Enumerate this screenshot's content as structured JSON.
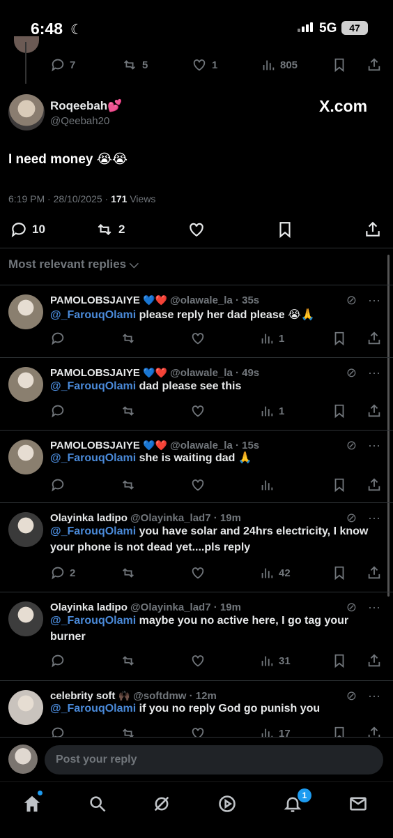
{
  "status": {
    "time": "6:48",
    "network": "5G",
    "battery": "47"
  },
  "prev_tweet": {
    "replies": "7",
    "reposts": "5",
    "likes": "1",
    "views": "805"
  },
  "tweet": {
    "name": "Roqeebah",
    "name_emoji": "💕",
    "handle": "@Qeebah20",
    "watermark": "X.com",
    "text": "I need money 😭😭",
    "time": "6:19 PM · 28/10/2025 · ",
    "views_count": "171",
    "views_label": " Views",
    "replies": "10",
    "reposts": "2"
  },
  "replies_header": "Most relevant replies",
  "replies": [
    {
      "name": "PAMOLOBSJAIYE",
      "badge": "💙❤️",
      "handle": "@olawale_la · 35s",
      "mention": "@_FarouqOlami",
      "text": " please reply her dad please 😭🙏",
      "reply_count": "",
      "views": "1"
    },
    {
      "name": "PAMOLOBSJAIYE",
      "badge": "💙❤️",
      "handle": "@olawale_la · 49s",
      "mention": "@_FarouqOlami",
      "text": " dad please see this",
      "reply_count": "",
      "views": "1"
    },
    {
      "name": "PAMOLOBSJAIYE",
      "badge": "💙❤️",
      "handle": "@olawale_la · 15s",
      "mention": "@_FarouqOlami",
      "text": " she is waiting dad 🙏",
      "reply_count": "",
      "views": ""
    },
    {
      "name": "Olayinka ladipo",
      "badge": "",
      "handle": "@Olayinka_lad7 · 19m",
      "mention": "@_FarouqOlami",
      "text": " you have solar and 24hrs electricity, I know your phone is not dead yet....pls reply",
      "reply_count": "2",
      "views": "42"
    },
    {
      "name": "Olayinka ladipo",
      "badge": "",
      "handle": "@Olayinka_lad7 · 19m",
      "mention": "@_FarouqOlami",
      "text": " maybe you no active here, I go tag your burner",
      "reply_count": "",
      "views": "31"
    },
    {
      "name": "celebrity soft",
      "badge": "🙌🏿",
      "handle": "@softdmw · 12m",
      "mention": "@_FarouqOlami",
      "text": " if you no reply God go punish you",
      "reply_count": "",
      "views": "17"
    }
  ],
  "compose_placeholder": "Post your reply",
  "notifications_badge": "1"
}
